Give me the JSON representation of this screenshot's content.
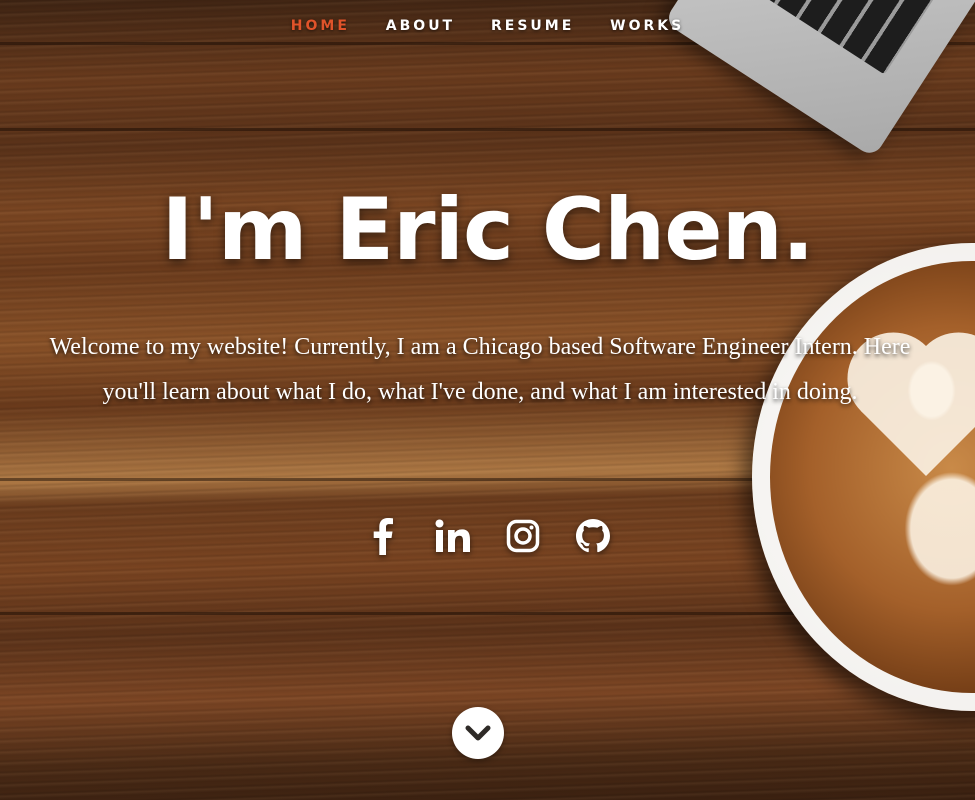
{
  "nav": {
    "items": [
      {
        "label": "HOME",
        "active": true
      },
      {
        "label": "ABOUT",
        "active": false
      },
      {
        "label": "RESUME",
        "active": false
      },
      {
        "label": "WORKS",
        "active": false
      }
    ],
    "active_color": "#e0532a"
  },
  "hero": {
    "title": "I'm Eric Chen.",
    "intro": "Welcome to my website! Currently, I am a Chicago based Software Engineer Intern. Here you'll learn about what I do, what I've done, and what I am interested in doing."
  },
  "social": [
    {
      "icon": "facebook-icon"
    },
    {
      "icon": "linkedin-icon"
    },
    {
      "icon": "instagram-icon"
    },
    {
      "icon": "github-icon"
    }
  ],
  "scroll": {
    "icon": "chevron-down-icon"
  }
}
